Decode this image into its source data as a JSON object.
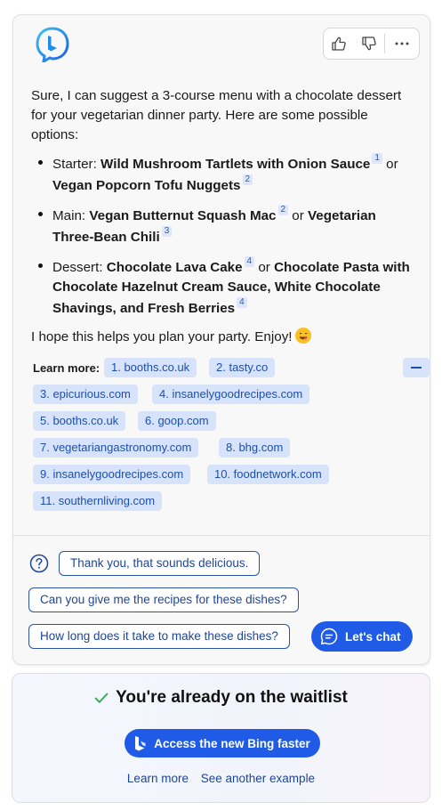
{
  "message": {
    "intro": "Sure, I can suggest a 3-course menu with a chocolate dessert for your vegetarian dinner party. Here are some possible options:",
    "courses": [
      {
        "label": "Starter: ",
        "option1": "Wild Mushroom Tartlets with Onion Sauce",
        "cite1": "1",
        "joiner": " or ",
        "option2": "Vegan Popcorn Tofu Nuggets",
        "cite2": "2"
      },
      {
        "label": "Main: ",
        "option1": "Vegan Butternut Squash Mac",
        "cite1": "2",
        "joiner": " or ",
        "option2": "Vegetarian Three-Bean Chili",
        "cite2": "3"
      },
      {
        "label": "Dessert: ",
        "option1": "Chocolate Lava Cake",
        "cite1": "4",
        "joiner": " or ",
        "option2": "Chocolate Pasta with Chocolate Hazelnut Cream Sauce, White Chocolate Shavings, and Fresh Berries",
        "cite2": "4"
      }
    ],
    "closing": "I hope this helps you plan your party. Enjoy!",
    "emoji": "yum-face-emoji"
  },
  "learn_more": {
    "label": "Learn more:",
    "sources": [
      "1. booths.co.uk",
      "2. tasty.co",
      "3. epicurious.com",
      "4. insanelygoodrecipes.com",
      "5. booths.co.uk",
      "6. goop.com",
      "7. vegetariangastronomy.com",
      "8. bhg.com",
      "9. insanelygoodrecipes.com",
      "10. foodnetwork.com",
      "11. southernliving.com"
    ]
  },
  "suggestions": [
    "Thank you, that sounds delicious.",
    "Can you give me the recipes for these dishes?",
    "How long does it take to make these dishes?"
  ],
  "chat_button": "Let's chat",
  "waitlist": {
    "title": "You're already on the waitlist",
    "access_button": "Access the new Bing faster",
    "links": [
      "Learn more",
      "See another example"
    ]
  },
  "colors": {
    "accent": "#1f5be6",
    "chip_bg": "#d7e3fb",
    "chip_text": "#1e4fa8",
    "check": "#2fa84f"
  },
  "icons": [
    "bing-logo-icon",
    "thumbs-up-icon",
    "thumbs-down-icon",
    "more-options-icon",
    "question-icon",
    "chat-bubble-icon",
    "check-icon",
    "bing-b-icon"
  ]
}
